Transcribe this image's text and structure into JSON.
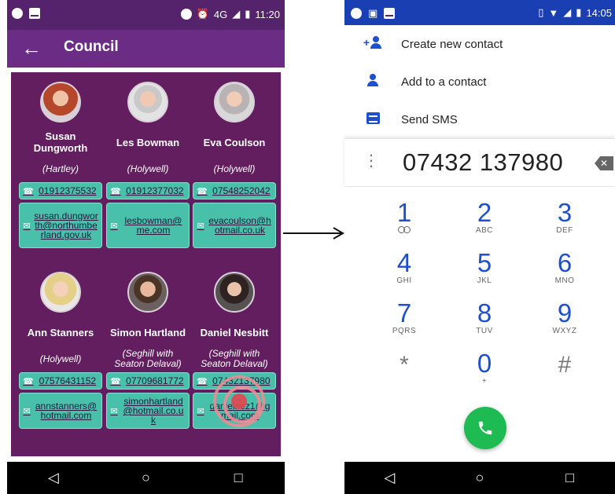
{
  "left": {
    "status": {
      "time": "11:20",
      "network": "4G"
    },
    "appbar": {
      "back_icon": "←",
      "title": "Council"
    },
    "councillors": [
      {
        "name": "Susan Dungworth",
        "ward": "(Hartley)",
        "phone": "01912375532",
        "email": "susan.dungworth@northumberland.gov.uk"
      },
      {
        "name": "Les Bowman",
        "ward": "(Holywell)",
        "phone": "01912377032",
        "email": "lesbowman@me.com"
      },
      {
        "name": "Eva Coulson",
        "ward": "(Holywell)",
        "phone": "07548252042",
        "email": "evacoulson@hotmail.co.uk"
      },
      {
        "name": "Ann Stanners",
        "ward": "(Holywell)",
        "phone": "07576431152",
        "email": "annstanners@hotmail.com"
      },
      {
        "name": "Simon Hartland",
        "ward": "(Seghill with Seaton Delaval)",
        "phone": "07709681772",
        "email": "simonhartland@hotmail.co.uk"
      },
      {
        "name": "Daniel Nesbitt",
        "ward": "(Seghill with Seaton Delaval)",
        "phone": "07432137980",
        "email": "danielnez1@gmail.com"
      }
    ],
    "nav": {
      "back": "◁",
      "home": "○",
      "recents": "□"
    }
  },
  "right": {
    "status": {
      "time": "14:05"
    },
    "menu": [
      {
        "label": "Create new contact",
        "icon": "add-person-icon"
      },
      {
        "label": "Add to a contact",
        "icon": "person-icon"
      },
      {
        "label": "Send SMS",
        "icon": "sms-icon"
      }
    ],
    "dialed_number": "07432 137980",
    "keypad": [
      {
        "digit": "1",
        "letters": ""
      },
      {
        "digit": "2",
        "letters": "ABC"
      },
      {
        "digit": "3",
        "letters": "DEF"
      },
      {
        "digit": "4",
        "letters": "GHI"
      },
      {
        "digit": "5",
        "letters": "JKL"
      },
      {
        "digit": "6",
        "letters": "MNO"
      },
      {
        "digit": "7",
        "letters": "PQRS"
      },
      {
        "digit": "8",
        "letters": "TUV"
      },
      {
        "digit": "9",
        "letters": "WXYZ"
      },
      {
        "digit": "*",
        "letters": ""
      },
      {
        "digit": "0",
        "letters": "+"
      },
      {
        "digit": "#",
        "letters": ""
      }
    ],
    "nav": {
      "back": "◁",
      "home": "○",
      "recents": "□"
    }
  },
  "colors": {
    "purple_dark": "#621e5f",
    "purple_appbar": "#6a2c85",
    "teal_button": "#48c0aa",
    "dialer_blue": "#1f4fd1",
    "call_green": "#1dbb52"
  }
}
